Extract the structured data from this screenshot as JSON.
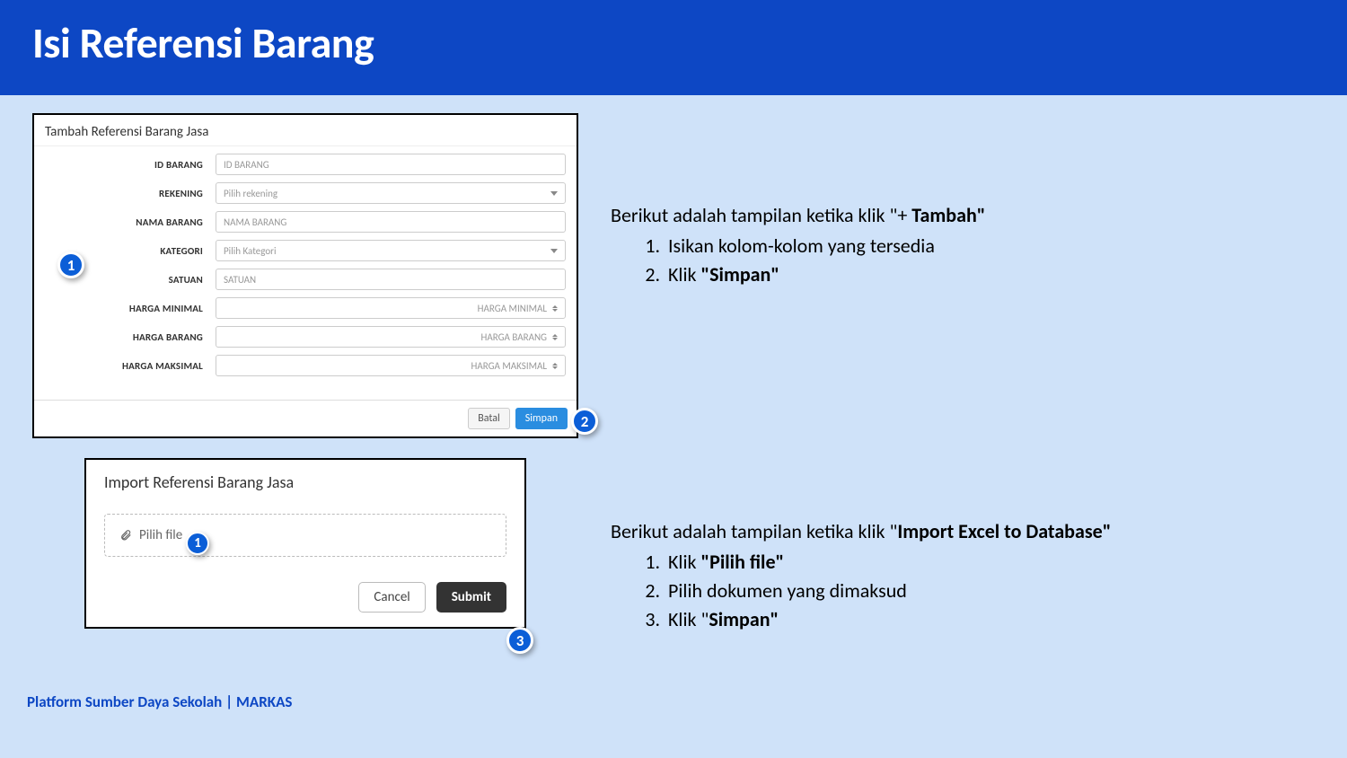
{
  "header": {
    "title": "Isi Referensi Barang"
  },
  "panel1": {
    "title": "Tambah Referensi Barang Jasa",
    "fields": {
      "id_barang": {
        "label": "ID BARANG",
        "placeholder": "ID BARANG"
      },
      "rekening": {
        "label": "REKENING",
        "placeholder": "Pilih rekening"
      },
      "nama_barang": {
        "label": "NAMA BARANG",
        "placeholder": "NAMA BARANG"
      },
      "kategori": {
        "label": "KATEGORI",
        "placeholder": "Pilih Kategori"
      },
      "satuan": {
        "label": "SATUAN",
        "placeholder": "SATUAN"
      },
      "harga_minimal": {
        "label": "HARGA MINIMAL",
        "placeholder": "HARGA MINIMAL"
      },
      "harga_barang": {
        "label": "HARGA BARANG",
        "placeholder": "HARGA BARANG"
      },
      "harga_maksimal": {
        "label": "HARGA MAKSIMAL",
        "placeholder": "HARGA MAKSIMAL"
      }
    },
    "buttons": {
      "batal": "Batal",
      "simpan": "Simpan"
    }
  },
  "panel2": {
    "title": "Import Referensi Barang Jasa",
    "pilih_file": "Pilih file",
    "buttons": {
      "cancel": "Cancel",
      "submit": "Submit"
    }
  },
  "badges": {
    "b1": "1",
    "b2": "2",
    "b3": "3",
    "import_b1": "1"
  },
  "desc_top": {
    "intro_a": "Berikut adalah tampilan ketika klik \"+ ",
    "intro_b": "Tambah\"",
    "items": [
      {
        "text": "Isikan kolom-kolom yang tersedia"
      },
      {
        "prefix": "Klik ",
        "bold": "\"Simpan\""
      }
    ]
  },
  "desc_bottom": {
    "intro_a": "Berikut adalah tampilan ketika klik \"",
    "intro_b": "Import Excel to Database\"",
    "items": [
      {
        "prefix": "Klik ",
        "bold": "\"Pilih file\""
      },
      {
        "text": "Pilih dokumen yang dimaksud"
      },
      {
        "prefix": "Klik \"",
        "bold": "Simpan\""
      }
    ]
  },
  "footer": "Platform Sumber Daya Sekolah | MARKAS"
}
